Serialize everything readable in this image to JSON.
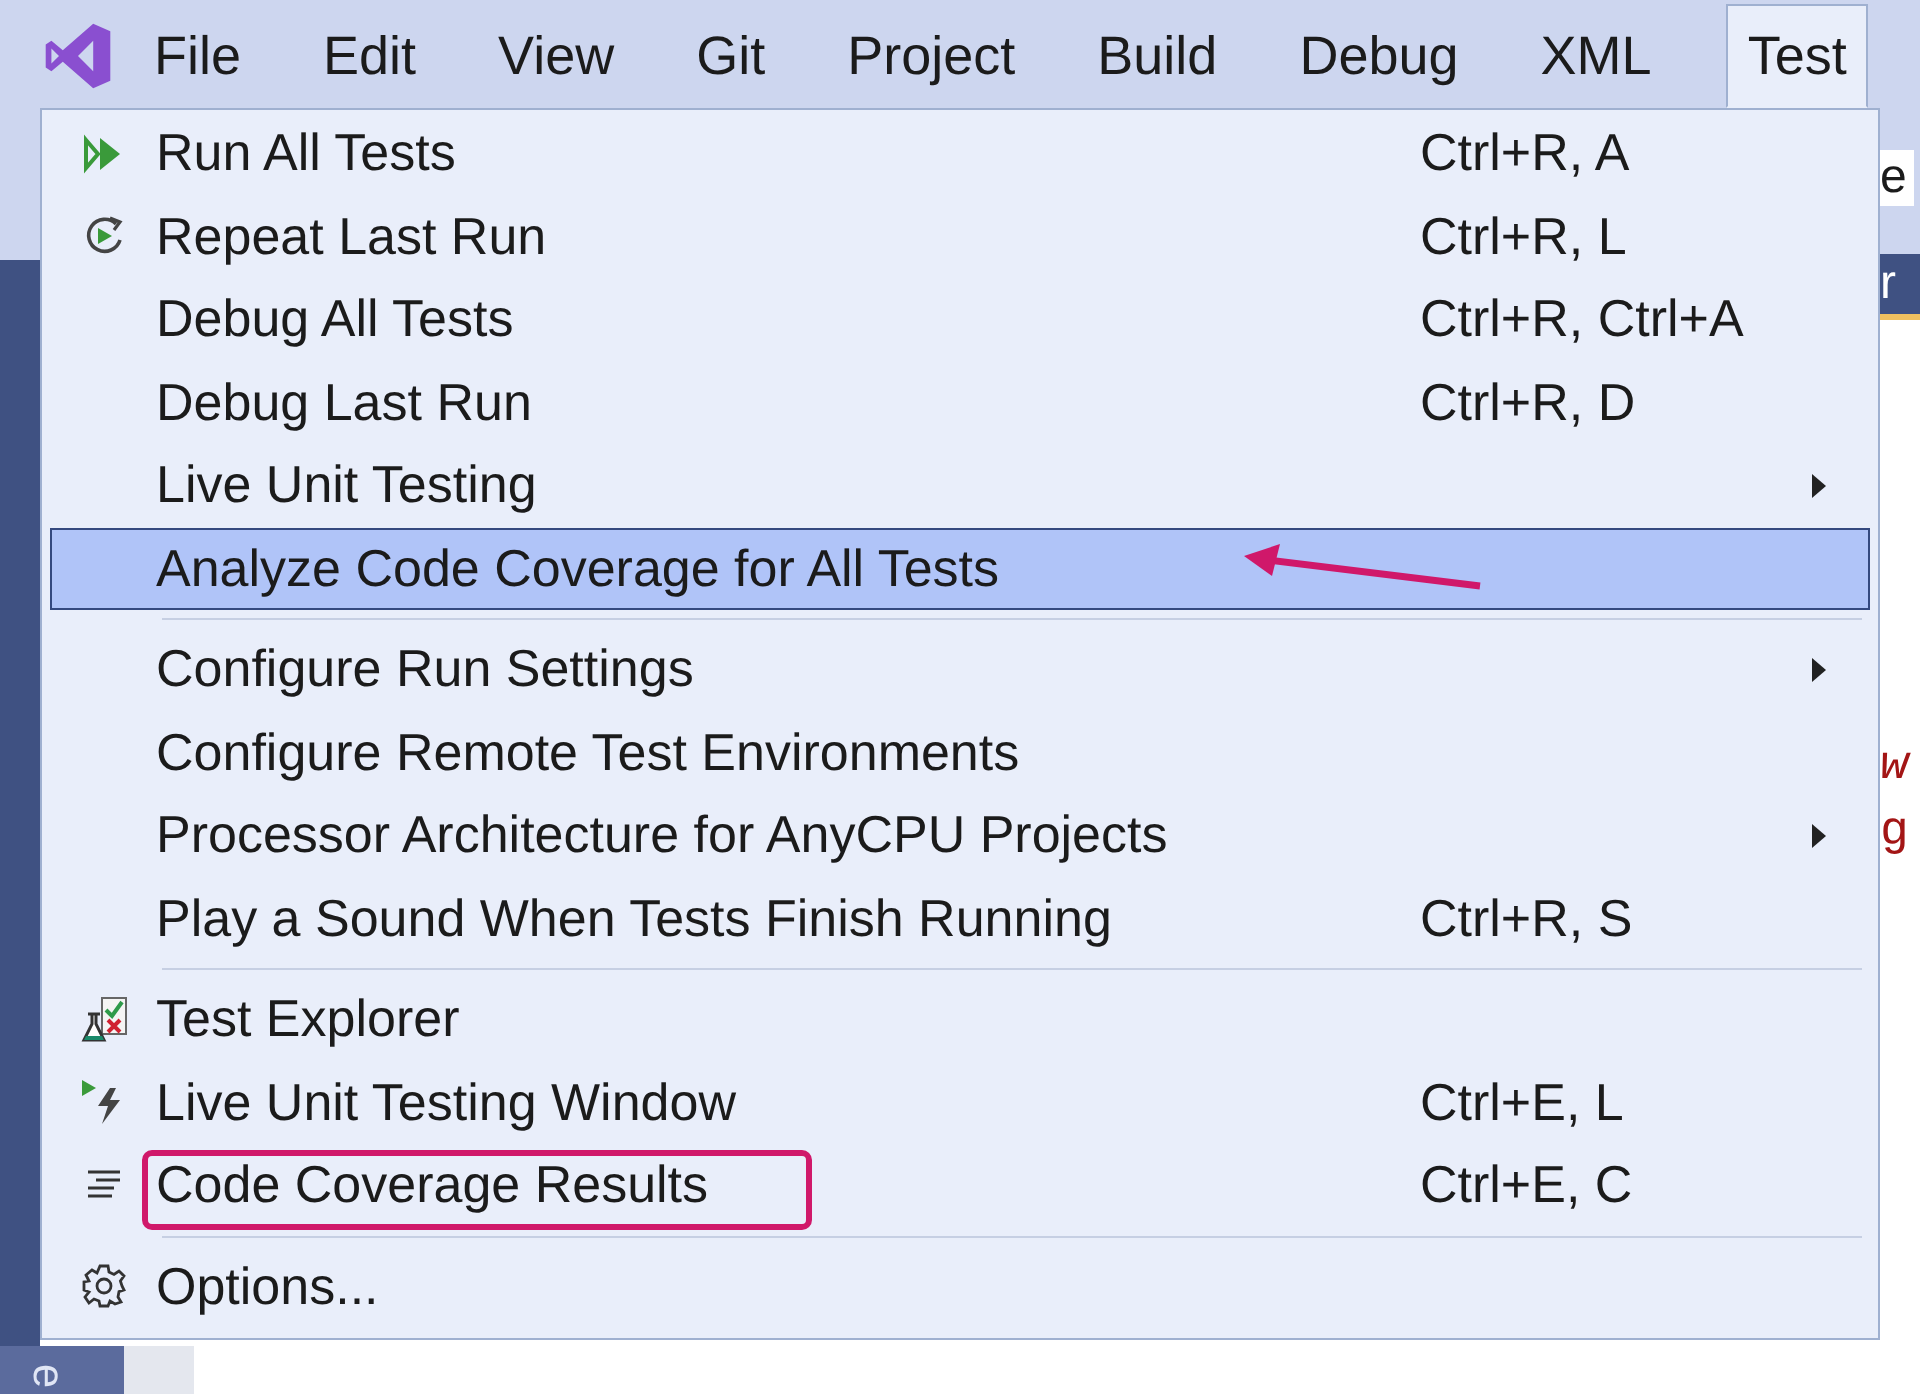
{
  "menubar": {
    "items": [
      {
        "label": "File",
        "selected": false
      },
      {
        "label": "Edit",
        "selected": false
      },
      {
        "label": "View",
        "selected": false
      },
      {
        "label": "Git",
        "selected": false
      },
      {
        "label": "Project",
        "selected": false
      },
      {
        "label": "Build",
        "selected": false
      },
      {
        "label": "Debug",
        "selected": false
      },
      {
        "label": "XML",
        "selected": false
      },
      {
        "label": "Test",
        "selected": true
      }
    ]
  },
  "menu": {
    "groups": [
      {
        "items": [
          {
            "label": "Run All Tests",
            "shortcut": "Ctrl+R, A",
            "submenu": false,
            "selected": false
          },
          {
            "label": "Repeat Last Run",
            "shortcut": "Ctrl+R, L",
            "submenu": false,
            "selected": false
          },
          {
            "label": "Debug All Tests",
            "shortcut": "Ctrl+R, Ctrl+A",
            "submenu": false,
            "selected": false
          },
          {
            "label": "Debug Last Run",
            "shortcut": "Ctrl+R, D",
            "submenu": false,
            "selected": false
          },
          {
            "label": "Live Unit Testing",
            "submenu": true,
            "selected": false
          },
          {
            "label": "Analyze Code Coverage for All Tests",
            "submenu": false,
            "selected": true,
            "annotation": {
              "kind": "arrow"
            }
          }
        ]
      },
      {
        "items": [
          {
            "label": "Configure Run Settings",
            "submenu": true,
            "selected": false
          },
          {
            "label": "Configure Remote Test Environments",
            "submenu": false,
            "selected": false
          },
          {
            "label": "Processor Architecture for AnyCPU Projects",
            "submenu": true,
            "selected": false
          },
          {
            "label": "Play a Sound When Tests Finish Running",
            "shortcut": "Ctrl+R, S",
            "submenu": false,
            "selected": false
          }
        ]
      },
      {
        "items": [
          {
            "label": "Test Explorer",
            "submenu": false,
            "selected": false
          },
          {
            "label": "Live Unit Testing Window",
            "shortcut": "Ctrl+E, L",
            "submenu": false,
            "selected": false
          },
          {
            "label": "Code Coverage Results",
            "shortcut": "Ctrl+E, C",
            "submenu": false,
            "selected": false,
            "annotation": {
              "kind": "box"
            }
          }
        ]
      },
      {
        "items": [
          {
            "label": "Options...",
            "submenu": false,
            "selected": false
          }
        ]
      }
    ]
  },
  "background": {
    "toolbar_fragment": "e",
    "tab_fragment": "r",
    "code_fragments": [
      "w",
      "g"
    ],
    "side_fragment": "e"
  }
}
